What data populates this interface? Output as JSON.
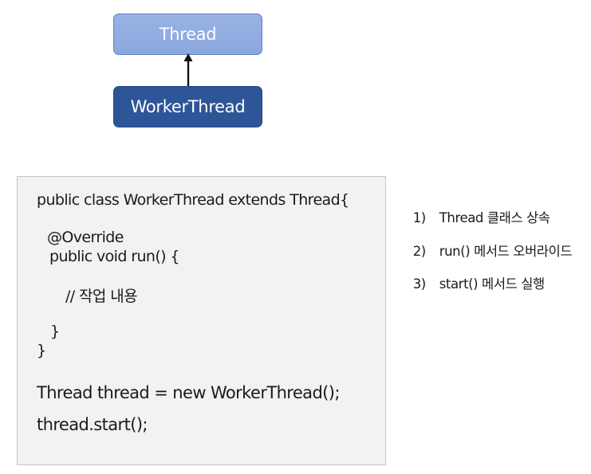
{
  "diagram": {
    "parent_class": "Thread",
    "child_class": "WorkerThread"
  },
  "code": {
    "lines": [
      "public class WorkerThread extends Thread{",
      "@Override",
      "public void run() {",
      "// 작업 내용",
      "}",
      "}",
      "Thread thread = new WorkerThread();",
      "thread.start();"
    ]
  },
  "notes": [
    {
      "num": "1)",
      "text": "Thread 클래스 상속"
    },
    {
      "num": "2)",
      "text": "run() 메서드 오버라이드"
    },
    {
      "num": "3)",
      "text": "start() 메서드 실행"
    }
  ],
  "colors": {
    "parent_box": "#8aa7df",
    "child_box": "#2e5597",
    "code_background": "#f2f2f2"
  }
}
